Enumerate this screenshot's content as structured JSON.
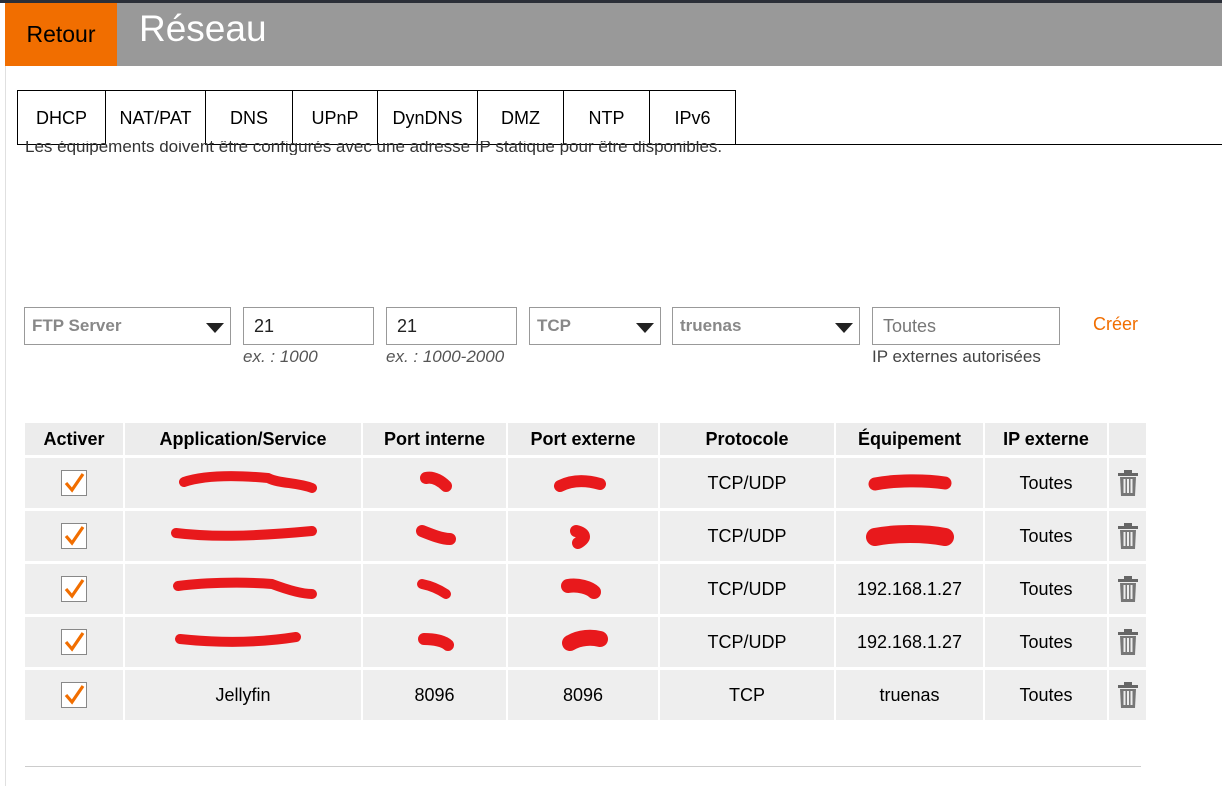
{
  "header": {
    "back_label": "Retour",
    "title": "Réseau"
  },
  "tabs": [
    {
      "label": "DHCP",
      "active": false
    },
    {
      "label": "NAT/PAT",
      "active": true
    },
    {
      "label": "DNS",
      "active": false
    },
    {
      "label": "UPnP",
      "active": false
    },
    {
      "label": "DynDNS",
      "active": false
    },
    {
      "label": "DMZ",
      "active": false
    },
    {
      "label": "NTP",
      "active": false
    },
    {
      "label": "IPv6",
      "active": false
    }
  ],
  "info_text": "Les équipements doivent être configurés avec une adresse IP statique pour être disponibles.",
  "form": {
    "service_value": "FTP Server",
    "internal_port_value": "21",
    "internal_port_hint": "ex. : 1000",
    "external_port_value": "21",
    "external_port_hint": "ex. : 1000-2000",
    "protocol_value": "TCP",
    "device_value": "truenas",
    "ip_placeholder": "Toutes",
    "ip_hint": "IP externes autorisées",
    "create_label": "Créer"
  },
  "table": {
    "headers": [
      "Activer",
      "Application/Service",
      "Port interne",
      "Port externe",
      "Protocole",
      "Équipement",
      "IP externe"
    ],
    "rows": [
      {
        "active": true,
        "app": "",
        "app_redacted": true,
        "port_int": "",
        "port_int_redacted": true,
        "port_ext": "",
        "port_ext_redacted": true,
        "protocol": "TCP/UDP",
        "device": "",
        "device_redacted": true,
        "ip": "Toutes"
      },
      {
        "active": true,
        "app": "",
        "app_redacted": true,
        "port_int": "",
        "port_int_redacted": true,
        "port_ext": "",
        "port_ext_redacted": true,
        "protocol": "TCP/UDP",
        "device": "",
        "device_redacted": true,
        "ip": "Toutes"
      },
      {
        "active": true,
        "app": "",
        "app_redacted": true,
        "port_int": "",
        "port_int_redacted": true,
        "port_ext": "",
        "port_ext_redacted": true,
        "protocol": "TCP/UDP",
        "device": "192.168.1.27",
        "device_redacted": false,
        "ip": "Toutes"
      },
      {
        "active": true,
        "app": "",
        "app_redacted": true,
        "port_int": "",
        "port_int_redacted": true,
        "port_ext": "",
        "port_ext_redacted": true,
        "protocol": "TCP/UDP",
        "device": "192.168.1.27",
        "device_redacted": false,
        "ip": "Toutes"
      },
      {
        "active": true,
        "app": "Jellyfin",
        "app_redacted": false,
        "port_int": "8096",
        "port_int_redacted": false,
        "port_ext": "8096",
        "port_ext_redacted": false,
        "protocol": "TCP",
        "device": "truenas",
        "device_redacted": false,
        "ip": "Toutes"
      }
    ]
  },
  "colors": {
    "accent": "#f16e00",
    "header_bg": "#999999",
    "redaction": "#e8191c",
    "table_bg": "#eeeeee"
  },
  "icons": {
    "checkbox": "checkmark-icon",
    "delete": "trash-icon",
    "dropdown": "caret-down-icon"
  }
}
